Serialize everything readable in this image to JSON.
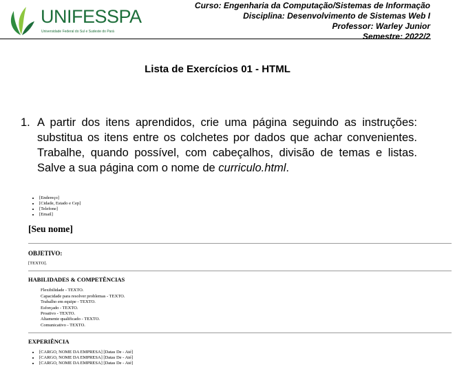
{
  "header": {
    "logo_text": "UNIFESSPA",
    "logo_subtitle": "Universidade Federal do Sul e Sudeste do Pará",
    "course": "Curso: Engenharia da Computação/Sistemas de Informação",
    "discipline": "Disciplina: Desenvolvimento de Sistemas Web I",
    "professor": "Professor: Warley Junior",
    "semester": "Semestre: 2022/2"
  },
  "title": "Lista de Exercícios 01 - HTML",
  "question": {
    "number": "1.",
    "text": "A partir dos itens aprendidos, crie uma página seguindo as instruções: substitua os itens entre os colchetes por dados que achar convenientes. Trabalhe, quando possível, com cabeçalhos, divisão de temas e listas. Salve a sua página com o nome de ",
    "filename": "curriculo.html",
    "end": "."
  },
  "example": {
    "contact": [
      "[Endereço]",
      "[Cidade, Estado e Cep]",
      "[Telefone]",
      "[Email]"
    ],
    "name": "[Seu nome]",
    "objective_title": "OBJETIVO:",
    "objective_text": "[TEXTO].",
    "skills_title": "HABILIDADES & COMPETÊNCIAS",
    "skills": [
      "Flexibilidade - TEXTO.",
      "Capacidade para resolver problemas - TEXTO.",
      "Trabalho em equipe - TEXTO.",
      "Esforçado - TEXTO.",
      "Proativo - TEXTO.",
      "Altamente qualificado - TEXTO.",
      "Comunicativo - TEXTO."
    ],
    "experience_title": "EXPERIÊNCIA",
    "experience": [
      "[CARGO, NOME DA EMPRESA] [Datas De - Até]",
      "[CARGO, NOME DA EMPRESA] [Datas De - Até]",
      "[CARGO, NOME DA EMPRESA] [Datas De - Até]"
    ]
  }
}
